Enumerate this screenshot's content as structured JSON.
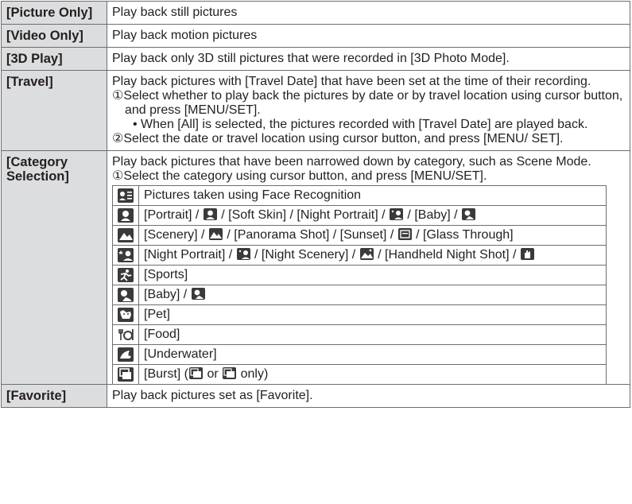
{
  "rows": [
    {
      "key": "[Picture Only]",
      "desc": "Play back still pictures"
    },
    {
      "key": "[Video Only]",
      "desc": "Play back motion pictures"
    },
    {
      "key": "[3D Play]",
      "desc": "Play back only 3D still pictures that were recorded in [3D Photo Mode]."
    },
    {
      "key": "[Travel]",
      "desc": "Play back pictures with [Travel Date] that have been set at the time of their recording.",
      "step1": "①Select whether to play back the pictures by date or by travel location using cursor button, and press [MENU/SET].",
      "note": "• When [All] is selected, the pictures recorded with [Travel Date] are played back.",
      "step2": "②Select the date or travel location using cursor button, and press [MENU/ SET]."
    },
    {
      "key": "[Category Selection]",
      "desc": "Play back pictures that have been narrowed down by category, such as Scene Mode.",
      "step1": "①Select the category using cursor button, and press [MENU/SET].",
      "categories": [
        {
          "icon": "face-recognition-icon",
          "parts": [
            "Pictures taken using Face Recognition"
          ]
        },
        {
          "icon": "portrait-icon",
          "parts": [
            "[Portrait] / ",
            " / [Soft Skin] / [Night Portrait] / ",
            " / [Baby] / "
          ]
        },
        {
          "icon": "scenery-icon",
          "parts": [
            "[Scenery] / ",
            " / [Panorama Shot] / [Sunset] / ",
            " / [Glass Through]"
          ]
        },
        {
          "icon": "night-portrait-icon",
          "parts": [
            "[Night Portrait] / ",
            " / [Night Scenery] / ",
            " / [Handheld Night Shot] / "
          ]
        },
        {
          "icon": "sports-icon",
          "parts": [
            "[Sports]"
          ]
        },
        {
          "icon": "baby-icon",
          "parts": [
            "[Baby] / "
          ]
        },
        {
          "icon": "pet-icon",
          "parts": [
            "[Pet]"
          ]
        },
        {
          "icon": "food-icon",
          "parts": [
            "[Food]"
          ]
        },
        {
          "icon": "underwater-icon",
          "parts": [
            "[Underwater]"
          ]
        },
        {
          "icon": "burst-icon",
          "parts": [
            "[Burst] (",
            " or ",
            " only)"
          ]
        }
      ]
    },
    {
      "key": "[Favorite]",
      "desc": "Play back pictures set as [Favorite]."
    }
  ],
  "colors": {
    "key_bg": "#dcddde",
    "border": "#6d6e71",
    "icon_bg": "#3a3a3c",
    "text": "#231f20"
  }
}
